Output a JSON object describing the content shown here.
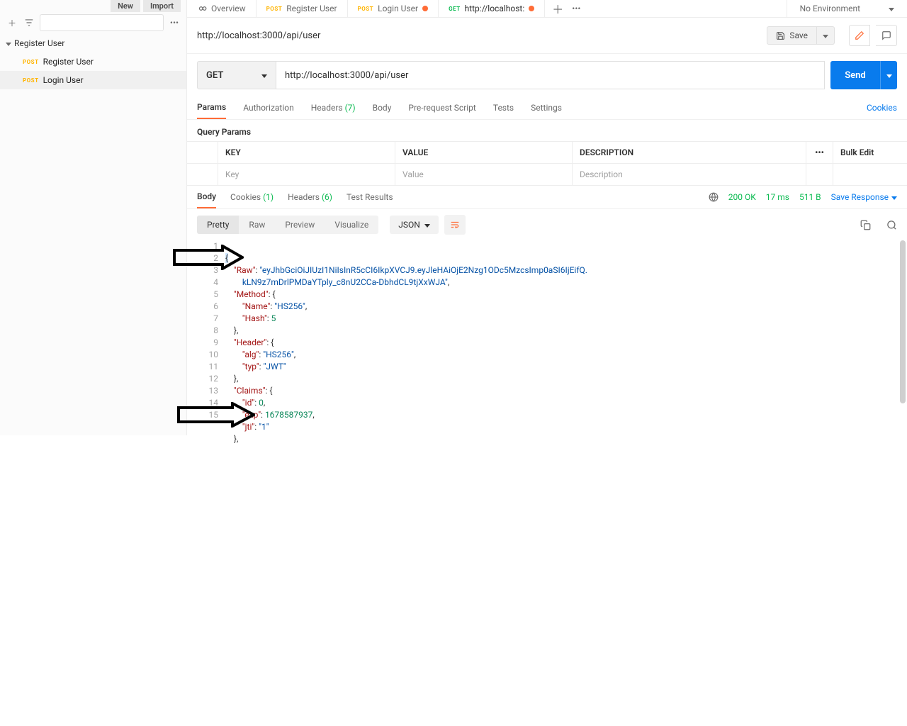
{
  "sidebar": {
    "btn_new": "New",
    "btn_import": "Import",
    "collection": "Register User",
    "items": [
      {
        "method": "POST",
        "name": "Register User"
      },
      {
        "method": "POST",
        "name": "Login User"
      }
    ]
  },
  "tabs": {
    "overview": "Overview",
    "list": [
      {
        "method": "POST",
        "label": "Register User",
        "dot": false
      },
      {
        "method": "POST",
        "label": "Login User",
        "dot": true
      },
      {
        "method": "GET",
        "label": "http://localhost:",
        "dot": true
      }
    ],
    "env": "No Environment"
  },
  "titlebar": {
    "title": "http://localhost:3000/api/user",
    "save": "Save"
  },
  "request": {
    "method": "GET",
    "url": "http://localhost:3000/api/user",
    "send": "Send"
  },
  "subtabs": {
    "params": "Params",
    "auth": "Authorization",
    "headers": "Headers",
    "headers_count": "(7)",
    "body": "Body",
    "prereq": "Pre-request Script",
    "tests": "Tests",
    "settings": "Settings",
    "cookies": "Cookies"
  },
  "section_label": "Query Params",
  "ptable": {
    "key": "KEY",
    "value": "VALUE",
    "desc": "DESCRIPTION",
    "bulk": "Bulk Edit",
    "key_ph": "Key",
    "value_ph": "Value",
    "desc_ph": "Description"
  },
  "resp_tabs": {
    "body": "Body",
    "cookies": "Cookies",
    "cookies_count": "(1)",
    "headers": "Headers",
    "headers_count": "(6)",
    "tests": "Test Results"
  },
  "resp_meta": {
    "status": "200 OK",
    "time": "17 ms",
    "size": "511 B",
    "save": "Save Response"
  },
  "resp_toolbar": {
    "pretty": "Pretty",
    "raw": "Raw",
    "preview": "Preview",
    "visualize": "Visualize",
    "format": "JSON"
  },
  "code": {
    "lines": [
      "1",
      "2",
      "3",
      "4",
      "5",
      "6",
      "7",
      "8",
      "9",
      "10",
      "11",
      "12",
      "13",
      "14",
      "15"
    ],
    "raw_key": "\"Raw\"",
    "raw_val": "\"eyJhbGciOiJIUzI1NiIsInR5cCI6IkpXVCJ9.eyJleHAiOjE2Nzg1ODc5MzcsImp0aSI6IjEifQ.",
    "raw_val2": "kLN9z7mDrlPMDaYTply_c8nU2CCa-DbhdCL9tjXxWJA\"",
    "method_key": "\"Method\"",
    "name_key": "\"Name\"",
    "name_val": "\"HS256\"",
    "hash_key": "\"Hash\"",
    "hash_val": "5",
    "header_key": "\"Header\"",
    "alg_key": "\"alg\"",
    "alg_val": "\"HS256\"",
    "typ_key": "\"typ\"",
    "typ_val": "\"JWT\"",
    "claims_key": "\"Claims\"",
    "id_key": "\"id\"",
    "id_val": "0",
    "exp_key": "\"exp\"",
    "exp_val": "1678587937",
    "jti_key": "\"jti\"",
    "jti_val": "\"1\""
  }
}
